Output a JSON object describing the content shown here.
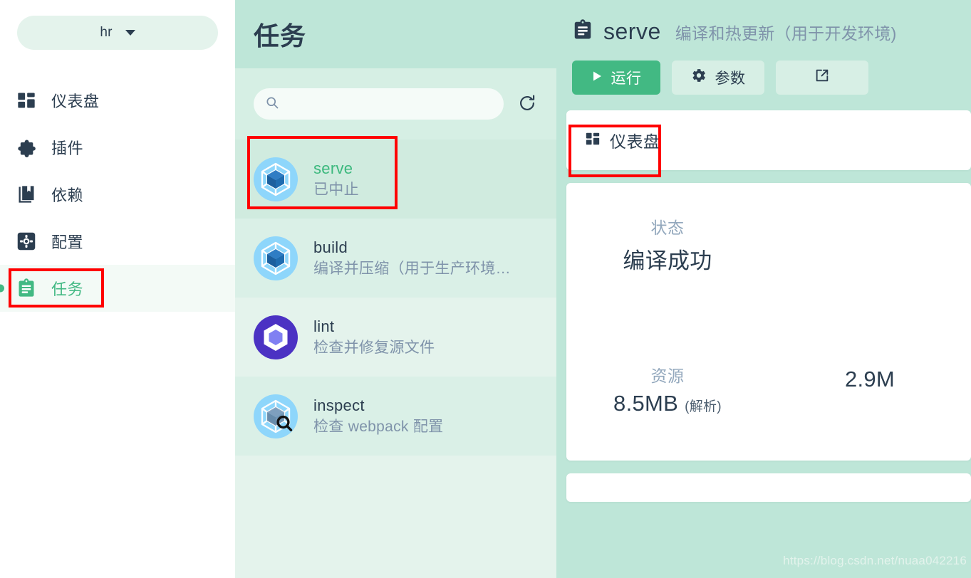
{
  "sidebar": {
    "project_selector": {
      "name": "hr",
      "icon": "chevron-down-icon"
    },
    "items": [
      {
        "label": "仪表盘",
        "icon": "dashboard-icon",
        "active": false
      },
      {
        "label": "插件",
        "icon": "puzzle-icon",
        "active": false
      },
      {
        "label": "依赖",
        "icon": "book-icon",
        "active": false
      },
      {
        "label": "配置",
        "icon": "gear-icon",
        "active": false
      },
      {
        "label": "任务",
        "icon": "clipboard-icon",
        "active": true
      }
    ]
  },
  "tasks_panel": {
    "title": "任务",
    "search": {
      "value": "",
      "placeholder": "",
      "icon": "search-icon"
    },
    "refresh_icon": "refresh-icon",
    "items": [
      {
        "name": "serve",
        "status": "已中止",
        "icon": "webpack-icon",
        "selected": true
      },
      {
        "name": "build",
        "status": "编译并压缩（用于生产环境…",
        "icon": "webpack-icon",
        "selected": false
      },
      {
        "name": "lint",
        "status": "检查并修复源文件",
        "icon": "eslint-icon",
        "selected": false
      },
      {
        "name": "inspect",
        "status": "检查 webpack 配置",
        "icon": "webpack-inspect-icon",
        "selected": false
      }
    ]
  },
  "detail": {
    "icon": "clipboard-icon",
    "title": "serve",
    "subtitle": "编译和热更新（用于开发环境)",
    "actions": {
      "run_label": "运行",
      "run_icon": "play-icon",
      "params_label": "参数",
      "params_icon": "gear-icon",
      "open_external_icon": "external-link-icon"
    },
    "dashboard_card": {
      "label": "仪表盘",
      "icon": "dashboard-icon"
    },
    "stats": [
      {
        "label": "状态",
        "value": "编译成功",
        "unit": ""
      },
      {
        "label": "",
        "value": "",
        "unit": ""
      },
      {
        "label": "资源",
        "value": "8.5MB",
        "unit": "(解析)"
      },
      {
        "label": "",
        "value": "2.9M",
        "unit": ""
      }
    ]
  },
  "watermark": "https://blog.csdn.net/nuaa042216",
  "colors": {
    "accent_green": "#42b983",
    "panel_bg": "#bee6d8",
    "list_bg": "#e4f3ec",
    "text_dark": "#2c3e50",
    "text_muted": "#7f93aa",
    "annotation_red": "#ff0000"
  }
}
